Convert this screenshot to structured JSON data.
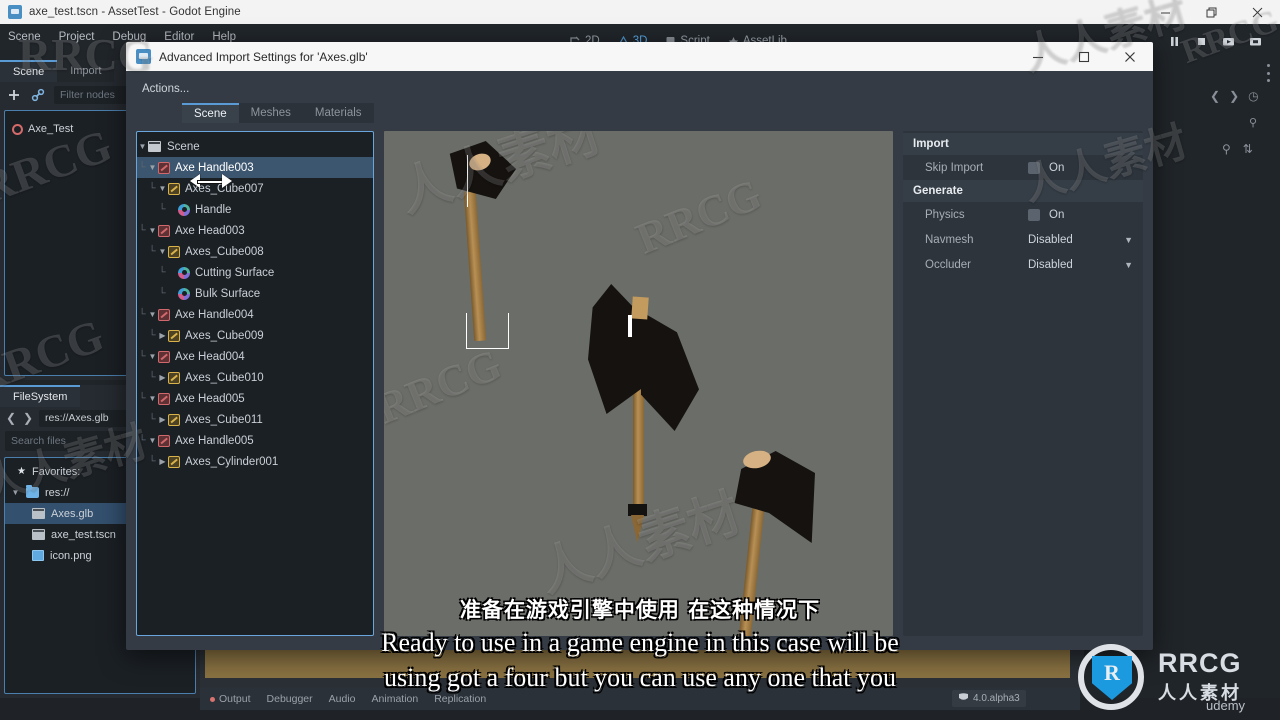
{
  "os_window": {
    "title": "axe_test.tscn - AssetTest - Godot Engine",
    "icon": "godot-icon",
    "minimize": "–",
    "maximize": "□",
    "close": "✕"
  },
  "godot_menu": {
    "items": [
      "Scene",
      "Project",
      "Debug",
      "Editor",
      "Help"
    ]
  },
  "godot_main_tabs": [
    {
      "label": "2D",
      "active": false
    },
    {
      "label": "3D",
      "active": true
    },
    {
      "label": "Script",
      "active": false
    },
    {
      "label": "AssetLib",
      "active": false
    }
  ],
  "scene_dock": {
    "tabs": [
      {
        "label": "Scene",
        "active": true
      },
      {
        "label": "Import",
        "active": false
      }
    ],
    "filter_placeholder": "Filter nodes",
    "add_icon": "plus-icon",
    "link_icon": "link-icon",
    "root_node": "Axe_Test"
  },
  "filesystem_dock": {
    "tab_label": "FileSystem",
    "back_icon": "chevron-left-icon",
    "forward_icon": "chevron-right-icon",
    "path": "res://Axes.glb",
    "search_placeholder": "Search files",
    "items": [
      {
        "label": "Favorites:",
        "icon": "star-icon",
        "depth": 0,
        "selected": false
      },
      {
        "label": "res://",
        "icon": "folder-icon",
        "depth": 0,
        "selected": false
      },
      {
        "label": "Axes.glb",
        "icon": "scene-file-icon",
        "depth": 1,
        "selected": true
      },
      {
        "label": "axe_test.tscn",
        "icon": "scene-file-icon",
        "depth": 1,
        "selected": false
      },
      {
        "label": "icon.png",
        "icon": "image-file-icon",
        "depth": 1,
        "selected": false
      }
    ]
  },
  "bottom_panel": {
    "items": [
      "Output",
      "Debugger",
      "Audio",
      "Animation",
      "Replication"
    ],
    "version": "4.0.alpha3"
  },
  "dialog": {
    "title": "Advanced Import Settings for 'Axes.glb'",
    "icon": "godot-icon",
    "minimize": "–",
    "maximize": "□",
    "close": "✕",
    "actions_label": "Actions...",
    "tabs": [
      {
        "label": "Scene",
        "active": true
      },
      {
        "label": "Meshes",
        "active": false
      },
      {
        "label": "Materials",
        "active": false
      }
    ],
    "tree": [
      {
        "label": "Scene",
        "depth": 0,
        "icon": "scene-folder-icon",
        "caret": "open",
        "selected": false
      },
      {
        "label": "Axe Handle003",
        "depth": 1,
        "icon": "node3d-red-icon",
        "caret": "open",
        "selected": true
      },
      {
        "label": "Axes_Cube007",
        "depth": 2,
        "icon": "mesh-node-yellow-icon",
        "caret": "open",
        "selected": false
      },
      {
        "label": "Handle",
        "depth": 3,
        "icon": "surface-icon",
        "caret": "none",
        "selected": false
      },
      {
        "label": "Axe Head003",
        "depth": 1,
        "icon": "node3d-red-icon",
        "caret": "open",
        "selected": false
      },
      {
        "label": "Axes_Cube008",
        "depth": 2,
        "icon": "mesh-node-yellow-icon",
        "caret": "open",
        "selected": false
      },
      {
        "label": "Cutting Surface",
        "depth": 3,
        "icon": "surface-icon",
        "caret": "none",
        "selected": false
      },
      {
        "label": "Bulk Surface",
        "depth": 3,
        "icon": "surface-icon",
        "caret": "none",
        "selected": false
      },
      {
        "label": "Axe Handle004",
        "depth": 1,
        "icon": "node3d-red-icon",
        "caret": "open",
        "selected": false
      },
      {
        "label": "Axes_Cube009",
        "depth": 2,
        "icon": "mesh-node-yellow-icon",
        "caret": "closed",
        "selected": false
      },
      {
        "label": "Axe Head004",
        "depth": 1,
        "icon": "node3d-red-icon",
        "caret": "open",
        "selected": false
      },
      {
        "label": "Axes_Cube010",
        "depth": 2,
        "icon": "mesh-node-yellow-icon",
        "caret": "closed",
        "selected": false
      },
      {
        "label": "Axe Head005",
        "depth": 1,
        "icon": "node3d-red-icon",
        "caret": "open",
        "selected": false
      },
      {
        "label": "Axes_Cube011",
        "depth": 2,
        "icon": "mesh-node-yellow-icon",
        "caret": "closed",
        "selected": false
      },
      {
        "label": "Axe Handle005",
        "depth": 1,
        "icon": "node3d-red-icon",
        "caret": "open",
        "selected": false
      },
      {
        "label": "Axes_Cylinder001",
        "depth": 2,
        "icon": "mesh-node-yellow-icon",
        "caret": "closed",
        "selected": false
      }
    ],
    "properties": {
      "sections": [
        {
          "title": "Import",
          "rows": [
            {
              "label": "Skip Import",
              "type": "checkbox",
              "value": "On",
              "checked": false
            }
          ]
        },
        {
          "title": "Generate",
          "rows": [
            {
              "label": "Physics",
              "type": "checkbox",
              "value": "On",
              "checked": false
            },
            {
              "label": "Navmesh",
              "type": "dropdown",
              "value": "Disabled"
            },
            {
              "label": "Occluder",
              "type": "dropdown",
              "value": "Disabled"
            }
          ]
        }
      ]
    }
  },
  "subtitles": {
    "chinese": "准备在游戏引擎中使用 在这种情况下",
    "english_line1": "Ready to use in a game engine in this case will be",
    "english_line2": "using got a four but you can use any one that you"
  },
  "branding": {
    "logo_text": "RRCG",
    "logo_cn": "人人素材",
    "source": "udemy",
    "watermark_latin": "RRCG",
    "watermark_cn": "人人素材"
  },
  "colors": {
    "accent_blue": "#5b9bd5",
    "selection_blue": "#3d566f",
    "dialog_bg": "#343b44",
    "editor_bg": "#202529",
    "viewport_bg": "#6b6d68",
    "node_red": "#d1686c",
    "node_yellow": "#d9b24a"
  }
}
